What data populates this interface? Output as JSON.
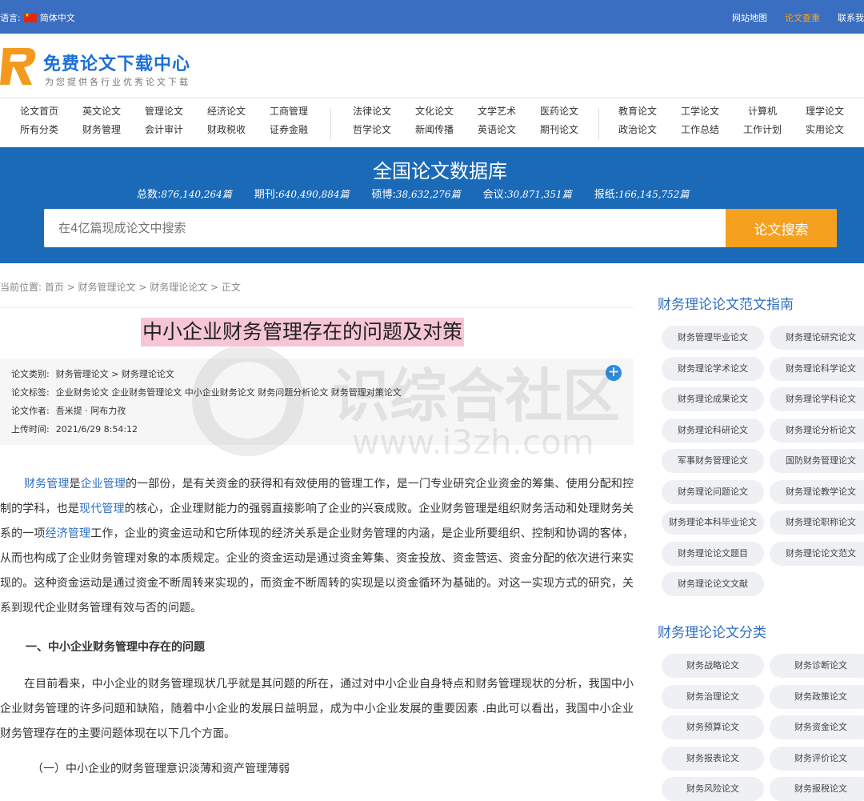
{
  "topbar": {
    "lang_label": "语言:",
    "lang_value": "简体中文",
    "links": [
      "网站地图",
      "论文查重",
      "联系我"
    ]
  },
  "logo": {
    "title": "免费论文下载中心",
    "subtitle": "为您提供各行业优秀论文下载"
  },
  "nav": {
    "groups": [
      [
        "论文首页",
        "英文论文",
        "管理论文",
        "经济论文",
        "工商管理",
        "所有分类",
        "财务管理",
        "会计审计",
        "财政税收",
        "证券金融"
      ],
      [
        "法律论文",
        "文化论文",
        "文学艺术",
        "医药论文",
        "哲学论文",
        "新闻传播",
        "英语论文",
        "期刊论文"
      ],
      [
        "教育论文",
        "工学论文",
        "计算机",
        "理学论文",
        "政治论文",
        "工作总结",
        "工作计划",
        "实用论文"
      ]
    ]
  },
  "hero": {
    "title": "全国论文数据库",
    "stats": [
      {
        "label": "总数:",
        "value": "876,140,264篇"
      },
      {
        "label": "期刊:",
        "value": "640,490,884篇"
      },
      {
        "label": "硕博:",
        "value": "38,632,276篇"
      },
      {
        "label": "会议:",
        "value": "30,871,351篇"
      },
      {
        "label": "报纸:",
        "value": "166,145,752篇"
      }
    ],
    "search_placeholder": "在4亿篇现成论文中搜索",
    "search_button": "论文搜索"
  },
  "breadcrumb": "当前位置: 首页 > 财务管理论文 > 财务理论论文 > 正文",
  "article": {
    "title": "中小企业财务管理存在的问题及对策",
    "meta": [
      {
        "label": "论文类别:",
        "value": "财务管理论文 > 财务理论论文"
      },
      {
        "label": "论文标签:",
        "value": "企业财务论文 企业财务管理论文 中小企业财务论文 财务问题分析论文 财务管理对策论文"
      },
      {
        "label": "论文作者:",
        "value": "吾米提 · 阿布力孜"
      },
      {
        "label": "上传时间:",
        "value": "2021/6/29 8:54:12"
      }
    ],
    "watermark": {
      "text": "识综合社区",
      "url": "www.i3zh.com"
    },
    "p1_links": [
      "财务管理",
      "企业管理",
      "现代管理",
      "经济管理"
    ],
    "p1_parts": [
      "是",
      "的一部份，是有关资金的获得和有效使用的管理工作，是一门专业研究企业资金的筹集、使用分配和控制的学科，也是",
      "的核心，企业理财能力的强弱直接影响了企业的兴衰成败。企业财务管理是组织财务活动和处理财务关系的一项",
      "工作，企业的资金运动和它所体现的经济关系是企业财务管理的内涵，是企业所要组织、控制和协调的客体，从而也构成了企业财务管理对象的本质规定。企业的资金运动是通过资金筹集、资金投放、资金营运、资金分配的依次进行来实现的。这种资金运动是通过资金不断周转来实现的，而资金不断周转的实现是以资金循环为基础的。对这一实现方式的研究，关系到现代企业财务管理有效与否的问题。"
    ],
    "heading1": "一、中小企业财务管理中存在的问题",
    "p2": "在目前看来，中小企业的财务管理现状几乎就是其问题的所在，通过对中小企业自身特点和财务管理现状的分析，我国中小企业财务管理的许多问题和缺陷，随着中小企业的发展日益明显，成为中小企业发展的重要因素 .由此可以看出，我国中小企业财务管理存在的主要问题体现在以下几个方面。",
    "sub1": "（一）中小企业的财务管理意识淡薄和资产管理薄弱"
  },
  "sidebar": {
    "guide_title": "财务理论论文范文指南",
    "guide_tags": [
      "财务管理毕业论文",
      "财务理论研究论文",
      "财务理论学术论文",
      "财务理论科学论文",
      "财务理论成果论文",
      "财务理论学科论文",
      "财务理论科研论文",
      "财务理论分析论文",
      "军事财务管理论文",
      "国防财务管理论文",
      "财务理论问题论文",
      "财务理论教学论文",
      "财务理论本科毕业论文",
      "财务理论职称论文",
      "财务理论论文题目",
      "财务理论论文范文",
      "财务理论论文文献"
    ],
    "category_title": "财务理论论文分类",
    "category_tags": [
      "财务战略论文",
      "财务诊断论文",
      "财务治理论文",
      "财务政策论文",
      "财务预算论文",
      "财务资金论文",
      "财务报表论文",
      "财务评价论文",
      "财务风险论文",
      "财务报税论文"
    ]
  }
}
